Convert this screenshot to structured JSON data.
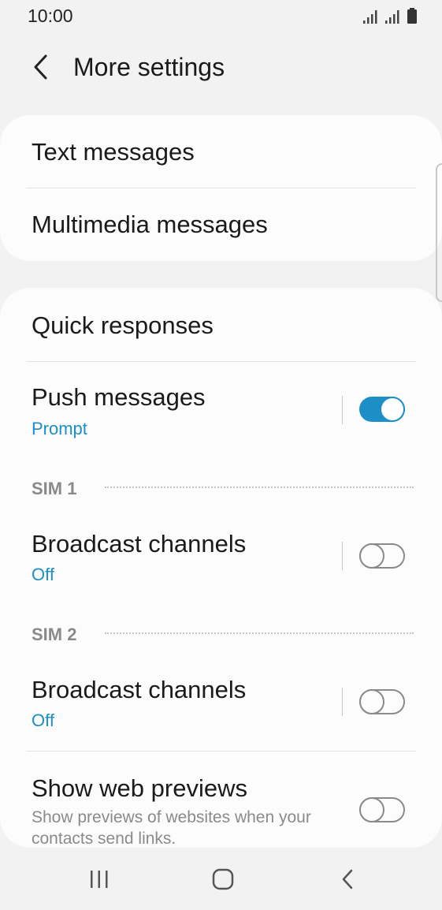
{
  "status_bar": {
    "time": "10:00"
  },
  "header": {
    "title": "More settings",
    "back_icon": "chevron-left-icon"
  },
  "card1": {
    "items": [
      {
        "label": "Text messages"
      },
      {
        "label": "Multimedia messages"
      }
    ]
  },
  "card2": {
    "quick_responses": {
      "label": "Quick responses"
    },
    "push_messages": {
      "label": "Push messages",
      "sub": "Prompt",
      "toggle": true
    },
    "sim1": {
      "header": "SIM 1",
      "broadcast": {
        "label": "Broadcast channels",
        "sub": "Off",
        "toggle": false
      }
    },
    "sim2": {
      "header": "SIM 2",
      "broadcast": {
        "label": "Broadcast channels",
        "sub": "Off",
        "toggle": false
      }
    },
    "web_previews": {
      "label": "Show web previews",
      "desc": "Show previews of websites when your contacts send links.",
      "toggle": false
    }
  },
  "nav_bar": {
    "recents_icon": "recents-icon",
    "home_icon": "home-icon",
    "back_icon": "back-icon"
  },
  "colors": {
    "accent": "#1b8fc6",
    "background": "#f2f2f2",
    "card": "#fcfcfc"
  }
}
